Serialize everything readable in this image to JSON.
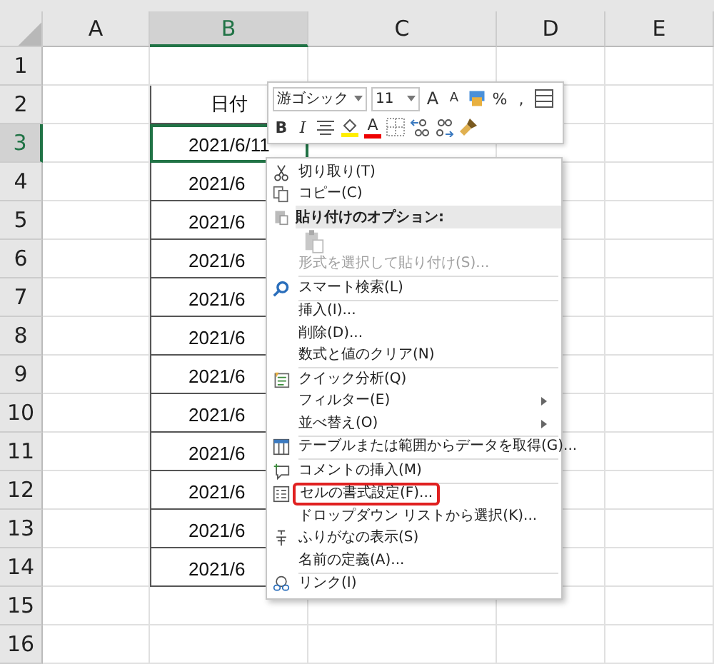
{
  "sheet": {
    "columns": [
      {
        "label": "A",
        "selected": false
      },
      {
        "label": "B",
        "selected": true
      },
      {
        "label": "C",
        "selected": false
      },
      {
        "label": "D",
        "selected": false
      },
      {
        "label": "E",
        "selected": false
      }
    ],
    "rows": [
      {
        "label": "1",
        "selected": false
      },
      {
        "label": "2",
        "selected": false,
        "b": {
          "text": "日付",
          "cut": false
        }
      },
      {
        "label": "3",
        "selected": true,
        "b": {
          "text": "2021/6/11",
          "cut": false
        }
      },
      {
        "label": "4",
        "selected": false,
        "b": {
          "text": "2021/6",
          "cut": true
        }
      },
      {
        "label": "5",
        "selected": false,
        "b": {
          "text": "2021/6",
          "cut": true
        }
      },
      {
        "label": "6",
        "selected": false,
        "b": {
          "text": "2021/6",
          "cut": true
        }
      },
      {
        "label": "7",
        "selected": false,
        "b": {
          "text": "2021/6",
          "cut": true
        }
      },
      {
        "label": "8",
        "selected": false,
        "b": {
          "text": "2021/6",
          "cut": true
        }
      },
      {
        "label": "9",
        "selected": false,
        "b": {
          "text": "2021/6",
          "cut": true
        }
      },
      {
        "label": "10",
        "selected": false,
        "b": {
          "text": "2021/6",
          "cut": true
        }
      },
      {
        "label": "11",
        "selected": false,
        "b": {
          "text": "2021/6",
          "cut": true
        }
      },
      {
        "label": "12",
        "selected": false,
        "b": {
          "text": "2021/6",
          "cut": true
        }
      },
      {
        "label": "13",
        "selected": false,
        "b": {
          "text": "2021/6",
          "cut": true
        }
      },
      {
        "label": "14",
        "selected": false,
        "b": {
          "text": "2021/6",
          "cut": true
        }
      },
      {
        "label": "15",
        "selected": false
      },
      {
        "label": "16",
        "selected": false
      }
    ]
  },
  "mini_toolbar": {
    "font": "游ゴシック",
    "size": "11",
    "grow_font": "A",
    "shrink_font": "A",
    "percent": "%",
    "comma": ",",
    "bold": "B",
    "italic": "I",
    "font_color": "A"
  },
  "context_menu": [
    {
      "kind": "item",
      "label": "切り取り(T)",
      "disabled": false,
      "submenu": false,
      "highlighted": false
    },
    {
      "kind": "item",
      "label": "コピー(C)",
      "disabled": false,
      "submenu": false,
      "highlighted": false
    },
    {
      "kind": "header",
      "label": "貼り付けのオプション:"
    },
    {
      "kind": "paste-options"
    },
    {
      "kind": "item",
      "label": "形式を選択して貼り付け(S)...",
      "disabled": true,
      "submenu": false,
      "highlighted": false
    },
    {
      "kind": "separator"
    },
    {
      "kind": "item",
      "label": "スマート検索(L)",
      "disabled": false,
      "submenu": false,
      "highlighted": false
    },
    {
      "kind": "separator"
    },
    {
      "kind": "item",
      "label": "挿入(I)...",
      "disabled": false,
      "submenu": false,
      "highlighted": false
    },
    {
      "kind": "item",
      "label": "削除(D)...",
      "disabled": false,
      "submenu": false,
      "highlighted": false
    },
    {
      "kind": "item",
      "label": "数式と値のクリア(N)",
      "disabled": false,
      "submenu": false,
      "highlighted": false
    },
    {
      "kind": "separator"
    },
    {
      "kind": "item",
      "label": "クイック分析(Q)",
      "disabled": false,
      "submenu": false,
      "highlighted": false
    },
    {
      "kind": "item",
      "label": "フィルター(E)",
      "disabled": false,
      "submenu": true,
      "highlighted": false
    },
    {
      "kind": "item",
      "label": "並べ替え(O)",
      "disabled": false,
      "submenu": true,
      "highlighted": false
    },
    {
      "kind": "separator"
    },
    {
      "kind": "item",
      "label": "テーブルまたは範囲からデータを取得(G)...",
      "disabled": false,
      "submenu": false,
      "highlighted": false
    },
    {
      "kind": "separator"
    },
    {
      "kind": "item",
      "label": "コメントの挿入(M)",
      "disabled": false,
      "submenu": false,
      "highlighted": false
    },
    {
      "kind": "separator"
    },
    {
      "kind": "item",
      "label": "セルの書式設定(F)...",
      "disabled": false,
      "submenu": false,
      "highlighted": true
    },
    {
      "kind": "item",
      "label": "ドロップダウン リストから選択(K)...",
      "disabled": false,
      "submenu": false,
      "highlighted": false
    },
    {
      "kind": "item",
      "label": "ふりがなの表示(S)",
      "disabled": false,
      "submenu": false,
      "highlighted": false
    },
    {
      "kind": "item",
      "label": "名前の定義(A)...",
      "disabled": false,
      "submenu": false,
      "highlighted": false
    },
    {
      "kind": "separator"
    },
    {
      "kind": "item",
      "label": "リンク(I)",
      "disabled": false,
      "submenu": false,
      "highlighted": false
    }
  ]
}
